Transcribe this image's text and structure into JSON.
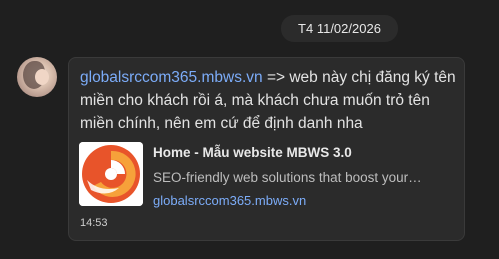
{
  "date_separator": "T4 11/02/2026",
  "message": {
    "link_text": "globalsrccom365.mbws.vn",
    "body_text": " => web này chị đăng ký tên miền cho khách rồi á, mà khách chưa muốn trỏ tên miền chính, nên em cứ để định danh nha",
    "time": "14:53",
    "preview": {
      "title": "Home - Mẫu website MBWS 3.0",
      "description": "SEO-friendly web solutions that boost your…",
      "url": "globalsrccom365.mbws.vn",
      "logo_colors": [
        "#e8542a",
        "#f6a13a"
      ]
    }
  }
}
